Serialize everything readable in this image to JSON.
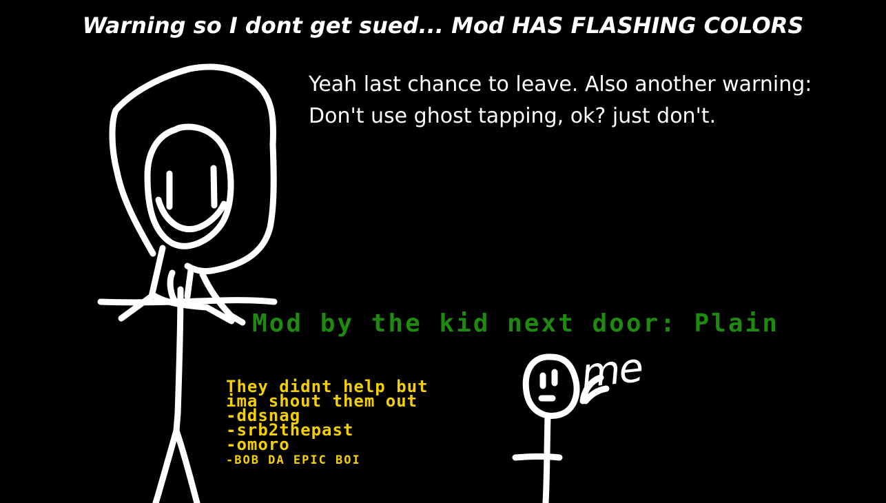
{
  "screen": {
    "title_warning": "Warning so I dont get sued... Mod HAS FLASHING COLORS",
    "message_lines": [
      "Yeah last chance to leave. Also another warning:",
      "Don't use ghost tapping, ok? just don't."
    ],
    "mod_credit": "Mod by the kid next door: Plain",
    "shoutouts": {
      "lines": [
        "They didnt help but",
        "ima shout them out",
        "-ddsnag",
        "-srb2thepast",
        "-omoro"
      ],
      "last_line": "-BOB DA EPIC BOI"
    },
    "me_label": "me"
  },
  "colors": {
    "background": "#000000",
    "text_white": "#ffffff",
    "credit_green": "#1f8a10",
    "shoutout_yellow": "#f5d000"
  },
  "icons": {
    "left_figure": "stick-figure-with-hair",
    "right_figure": "small-stick-figure",
    "arrow": "arrow-pointing-left"
  }
}
